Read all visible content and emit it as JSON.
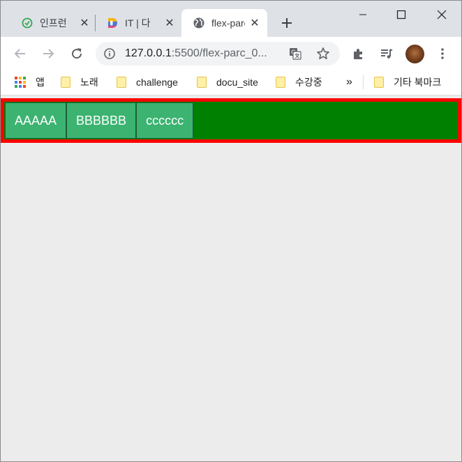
{
  "tabs": [
    {
      "title": "인프런",
      "icon": "inflearn-icon"
    },
    {
      "title": "IT | 다",
      "icon": "d-logo-icon"
    },
    {
      "title": "flex-parc",
      "icon": "globe-icon",
      "active": true
    }
  ],
  "address": {
    "host": "127.0.0.1",
    "path": ":5500/flex-parc_0..."
  },
  "bookmarks": {
    "apps_label": "앱",
    "items": [
      "노래",
      "challenge",
      "docu_site",
      "수강중"
    ],
    "overflow": "»",
    "other": "기타 북마크"
  },
  "page": {
    "items": [
      "AAAAA",
      "BBBBBB",
      "cccccc"
    ],
    "colors": {
      "container_border": "#ff0000",
      "container_bg": "#008000",
      "item_bg": "#3cb371"
    }
  }
}
